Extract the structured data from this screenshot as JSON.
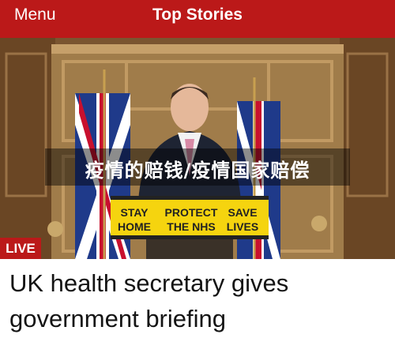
{
  "header": {
    "menu_label": "Menu",
    "title": "Top Stories"
  },
  "hero": {
    "overlay_caption": "疫情的赔钱/疫情国家赔偿",
    "live_badge": "LIVE",
    "lectern_sign": {
      "line1_items": [
        "STAY",
        "PROTECT",
        "SAVE"
      ],
      "line2_items": [
        "HOME",
        "THE NHS",
        "LIVES"
      ]
    }
  },
  "story": {
    "headline": "UK health secretary gives government briefing"
  },
  "colors": {
    "brand_red": "#bb1919",
    "sign_yellow": "#f5d40f"
  }
}
